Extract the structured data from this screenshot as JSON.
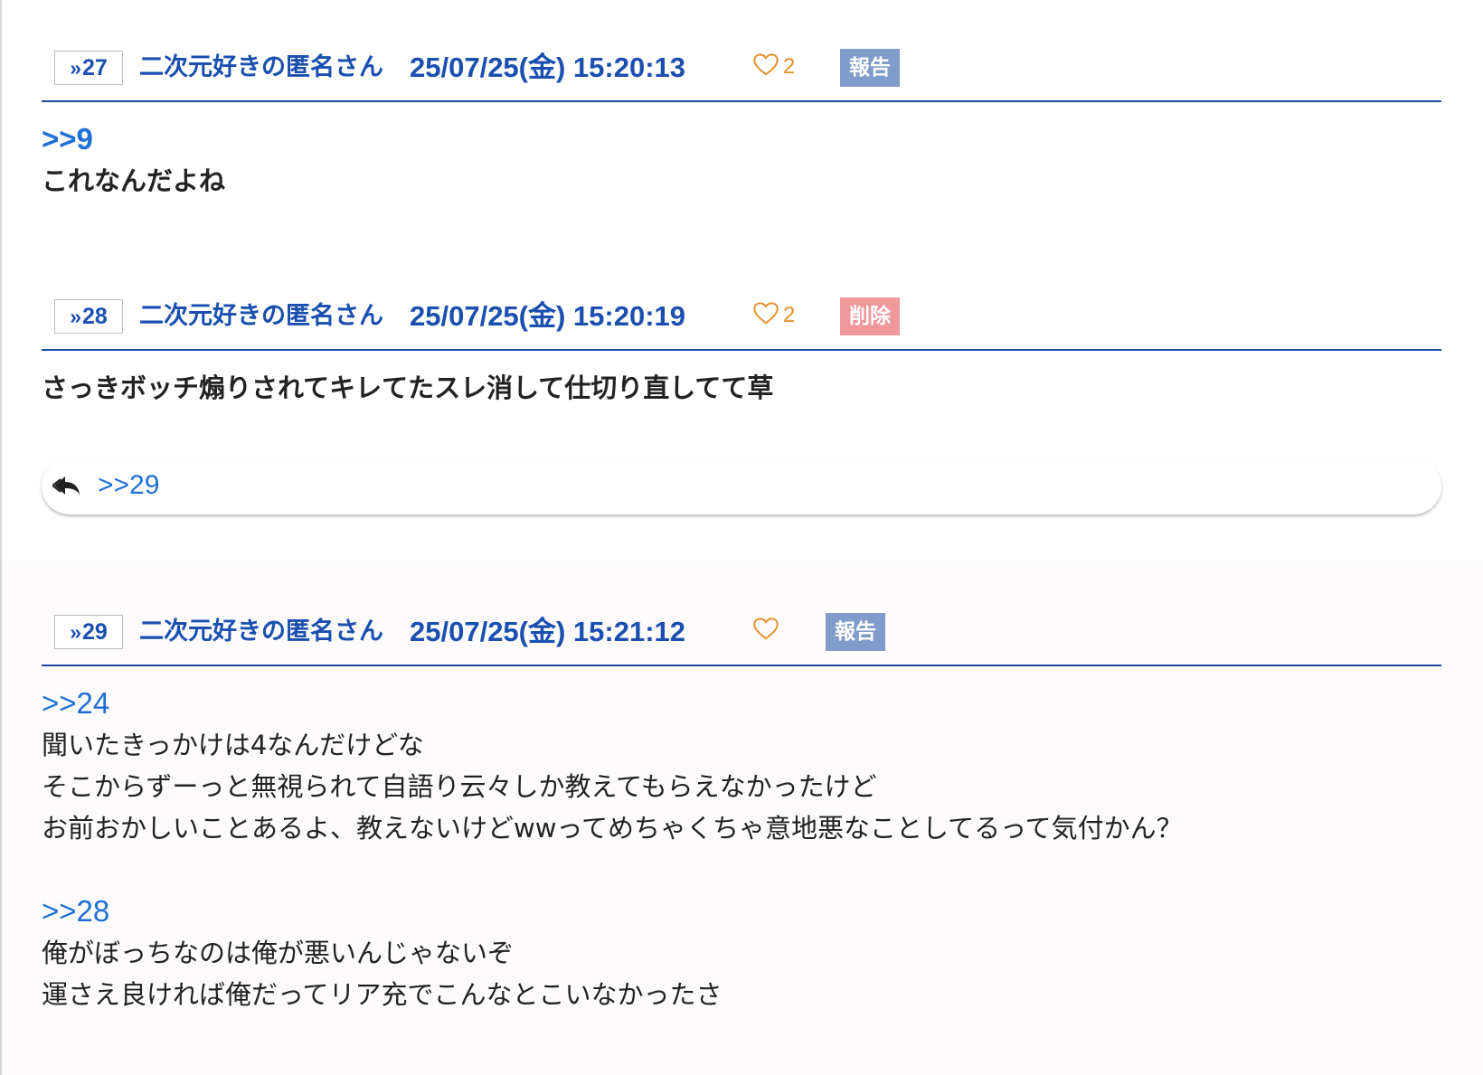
{
  "posts": [
    {
      "number": "27",
      "name": "二次元好きの匿名さん",
      "date": "25/07/25(金) 15:20:13",
      "likes": "2",
      "action": "報告",
      "anchor": ">>9",
      "lines": [
        "これなんだよね"
      ]
    },
    {
      "number": "28",
      "name": "二次元好きの匿名さん",
      "date": "25/07/25(金) 15:20:19",
      "likes": "2",
      "action": "削除",
      "lines": [
        "さっきボッチ煽りされてキレてたスレ消して仕切り直してて草"
      ],
      "reply_link": ">>29"
    },
    {
      "number": "29",
      "name": "二次元好きの匿名さん",
      "date": "25/07/25(金) 15:21:12",
      "likes": "",
      "action": "報告",
      "anchor": ">>24",
      "lines": [
        "聞いたきっかけは4なんだけどな",
        "そこからずーっと無視られて自語り云々しか教えてもらえなかったけど",
        "お前おかしいことあるよ、教えないけどwwってめちゃくちゃ意地悪なことしてるって気付かん？"
      ],
      "anchor2": ">>28",
      "lines2": [
        "俺がぼっちなのは俺が悪いんじゃないぞ",
        "運さえ良ければ俺だってリア充でこんなとこいなかったさ"
      ]
    }
  ],
  "icons": {
    "res_number": "double-chevron-icon",
    "like": "heart-outline-icon",
    "reply": "reply-arrow-icon"
  },
  "colors": {
    "link": "#1a4fb0",
    "anchor": "#1f6fd6",
    "like": "#e6912a",
    "report_badge": "#7f9cca",
    "delete_badge": "#f0979b",
    "divider": "#1b4aa3"
  }
}
